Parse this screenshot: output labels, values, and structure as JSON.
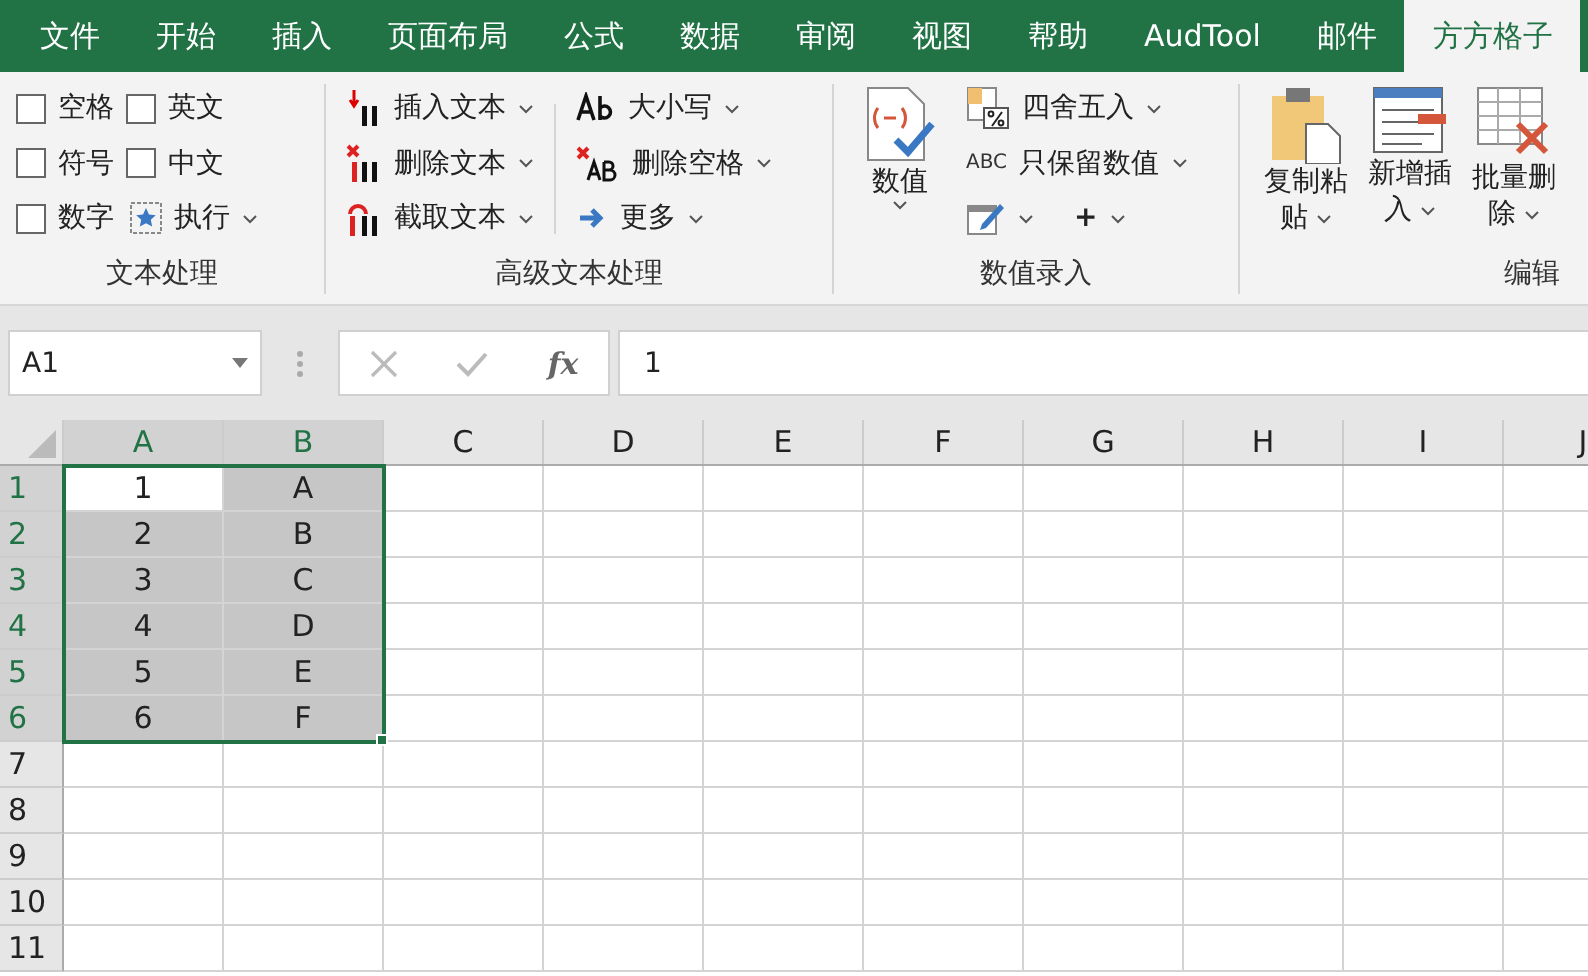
{
  "menu_tabs": [
    {
      "label": "文件",
      "selected": false
    },
    {
      "label": "开始",
      "selected": false
    },
    {
      "label": "插入",
      "selected": false
    },
    {
      "label": "页面布局",
      "selected": false
    },
    {
      "label": "公式",
      "selected": false
    },
    {
      "label": "数据",
      "selected": false
    },
    {
      "label": "审阅",
      "selected": false
    },
    {
      "label": "视图",
      "selected": false
    },
    {
      "label": "帮助",
      "selected": false
    },
    {
      "label": "AudTool",
      "selected": false
    },
    {
      "label": "邮件",
      "selected": false
    },
    {
      "label": "方方格子",
      "selected": true
    }
  ],
  "ribbon": {
    "text_group": {
      "label": "文本处理",
      "checkboxes": [
        {
          "label": "空格",
          "checked": false
        },
        {
          "label": "英文",
          "checked": false
        },
        {
          "label": "符号",
          "checked": false
        },
        {
          "label": "中文",
          "checked": false
        },
        {
          "label": "数字",
          "checked": false
        }
      ],
      "run_button": "执行"
    },
    "advanced_group": {
      "label": "高级文本处理",
      "buttons": [
        {
          "label": "插入文本",
          "kind": "insert"
        },
        {
          "label": "大小写",
          "kind": "case"
        },
        {
          "label": "删除文本",
          "kind": "delete"
        },
        {
          "label": "删除空格",
          "kind": "trim"
        },
        {
          "label": "截取文本",
          "kind": "cut"
        },
        {
          "label": "更多",
          "kind": "more"
        }
      ]
    },
    "number_group": {
      "label": "数值录入",
      "big_button": "数值",
      "buttons": [
        {
          "label": "四舍五入",
          "kind": "round"
        },
        {
          "label": "只保留数值",
          "kind": "abc",
          "icon_text": "ABC"
        }
      ],
      "plus_button": "+"
    },
    "edit_group": {
      "label": "编辑",
      "buttons": [
        {
          "label": "复制粘贴",
          "kind": "paste"
        },
        {
          "label": "新增插入",
          "kind": "insert"
        },
        {
          "label": "批量删除",
          "kind": "delete"
        }
      ]
    }
  },
  "formula_bar": {
    "name_box": "A1",
    "fx": "fx",
    "value": "1"
  },
  "sheet": {
    "columns": [
      {
        "label": "A",
        "selected": true
      },
      {
        "label": "B",
        "selected": true
      },
      {
        "label": "C",
        "selected": false
      },
      {
        "label": "D",
        "selected": false
      },
      {
        "label": "E",
        "selected": false
      },
      {
        "label": "F",
        "selected": false
      },
      {
        "label": "G",
        "selected": false
      },
      {
        "label": "H",
        "selected": false
      },
      {
        "label": "I",
        "selected": false
      },
      {
        "label": "J",
        "selected": false
      }
    ],
    "rows": [
      {
        "label": "1",
        "selected": true,
        "cells": [
          {
            "text": "1",
            "selected": true,
            "active": true
          },
          {
            "text": "A",
            "selected": true,
            "active": false
          }
        ]
      },
      {
        "label": "2",
        "selected": true,
        "cells": [
          {
            "text": "2",
            "selected": true,
            "active": false
          },
          {
            "text": "B",
            "selected": true,
            "active": false
          }
        ]
      },
      {
        "label": "3",
        "selected": true,
        "cells": [
          {
            "text": "3",
            "selected": true,
            "active": false
          },
          {
            "text": "C",
            "selected": true,
            "active": false
          }
        ]
      },
      {
        "label": "4",
        "selected": true,
        "cells": [
          {
            "text": "4",
            "selected": true,
            "active": false
          },
          {
            "text": "D",
            "selected": true,
            "active": false
          }
        ]
      },
      {
        "label": "5",
        "selected": true,
        "cells": [
          {
            "text": "5",
            "selected": true,
            "active": false
          },
          {
            "text": "E",
            "selected": true,
            "active": false
          }
        ]
      },
      {
        "label": "6",
        "selected": true,
        "cells": [
          {
            "text": "6",
            "selected": true,
            "active": false
          },
          {
            "text": "F",
            "selected": true,
            "active": false
          }
        ]
      },
      {
        "label": "7",
        "selected": false,
        "cells": []
      },
      {
        "label": "8",
        "selected": false,
        "cells": []
      },
      {
        "label": "9",
        "selected": false,
        "cells": []
      },
      {
        "label": "10",
        "selected": false,
        "cells": []
      },
      {
        "label": "11",
        "selected": false,
        "cells": []
      }
    ]
  }
}
